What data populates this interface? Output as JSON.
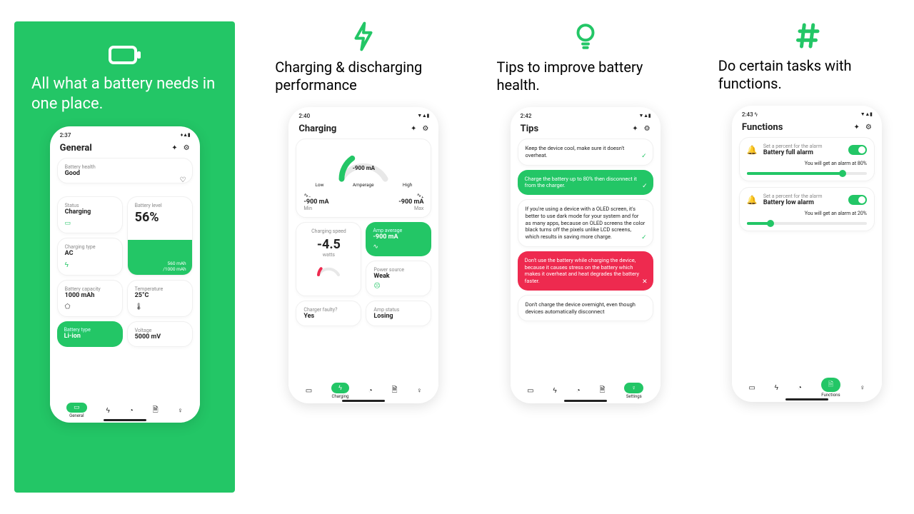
{
  "accent": "#23c666",
  "danger": "#ee2a4f",
  "promos": [
    {
      "headline": "All what a battery needs in one place."
    },
    {
      "headline": "Charging & discharging performance"
    },
    {
      "headline": "Tips to improve battery health."
    },
    {
      "headline": "Do certain tasks with functions."
    }
  ],
  "nav": {
    "general": "General",
    "charging": "Charging",
    "settings": "Settings",
    "functions": "Functions"
  },
  "general": {
    "time": "2:37",
    "title": "General",
    "health_lbl": "Battery health",
    "health_val": "Good",
    "status_lbl": "Status",
    "status_val": "Charging",
    "level_lbl": "Battery level",
    "level_val": "56%",
    "level_sub": "560 mAh\n/1000 mAh",
    "chg_type_lbl": "Charging type",
    "chg_type_val": "AC",
    "capacity_lbl": "Battery capacity",
    "capacity_val": "1000 mAh",
    "temp_lbl": "Temperature",
    "temp_val": "25°C",
    "type_lbl": "Battery type",
    "type_val": "Li-ion",
    "volt_lbl": "Voltage",
    "volt_val": "5000 mV"
  },
  "charging": {
    "time": "2:40",
    "title": "Charging",
    "gauge_val": "-900 mA",
    "gauge_low": "Low",
    "gauge_high": "High",
    "gauge_unit": "Amperage",
    "min_val": "-900 mA",
    "min_lbl": "Min",
    "max_val": "-900 mA",
    "max_lbl": "Max",
    "speed_lbl": "Charging speed",
    "speed_val": "-4.5",
    "speed_unit": "watts",
    "avg_lbl": "Amp average",
    "avg_val": "-900 mA",
    "pwr_lbl": "Power source",
    "pwr_val": "Weak",
    "faulty_lbl": "Charger faulty?",
    "faulty_val": "Yes",
    "amp_status_lbl": "Amp status",
    "amp_status_val": "Losing"
  },
  "tips": {
    "time": "2:42",
    "title": "Tips",
    "t1": "Keep the device cool, make sure it doesn't overheat.",
    "t2": "Charge the battery up to 80% then disconnect it from the charger.",
    "t3": "If you're using a device with a  OLED screen, it's better to use dark mode for your system and for as many apps, because on OLED screens the color black turns off the pixels unlike LCD screens, which results in saving more charge.",
    "t4": "Don't use the battery while charging the device, because it causes stress on the battery which makes it overheat and heat degrades the battery faster.",
    "t5": "Don't charge the device overnight, even though devices automatically disconnect"
  },
  "functions": {
    "time": "2:43",
    "title": "Functions",
    "f1_sub": "Set a percent for the alarm",
    "f1_title": "Battery full alarm",
    "f1_msg": "You will get an alarm at 80%",
    "f2_sub": "Set a percent for the alarm",
    "f2_title": "Battery low alarm",
    "f2_msg": "You will get an alarm at 20%"
  }
}
